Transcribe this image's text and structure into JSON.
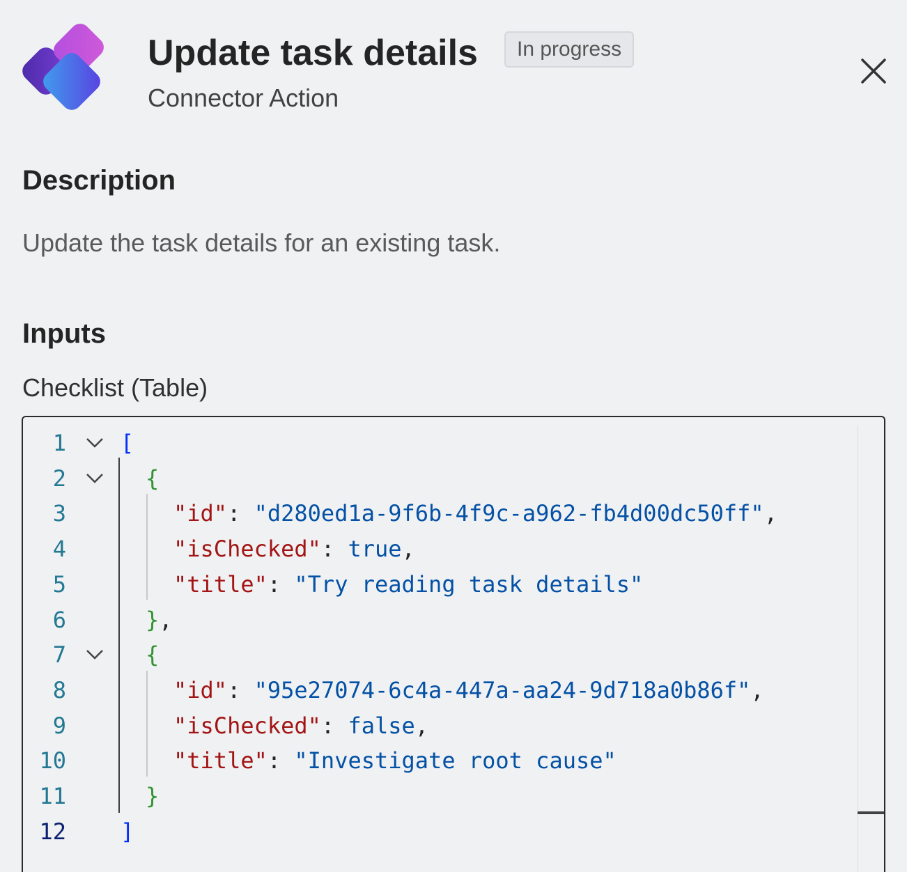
{
  "header": {
    "title": "Update task details",
    "status_badge": "In progress",
    "subtitle": "Connector Action",
    "app_icon": "planner-logo-icon",
    "close_icon": "close-icon"
  },
  "description": {
    "heading": "Description",
    "text": "Update the task details for an existing task."
  },
  "inputs": {
    "heading": "Inputs",
    "field_label": "Checklist (Table)",
    "line_numbers": [
      "1",
      "2",
      "3",
      "4",
      "5",
      "6",
      "7",
      "8",
      "9",
      "10",
      "11",
      "12"
    ],
    "lines": [
      {
        "open": "["
      },
      {
        "open": "{"
      },
      {
        "key": "\"id\"",
        "sep": ": ",
        "value": "\"d280ed1a-9f6b-4f9c-a962-fb4d00dc50ff\"",
        "end": ","
      },
      {
        "key": "\"isChecked\"",
        "sep": ": ",
        "value": "true",
        "end": ","
      },
      {
        "key": "\"title\"",
        "sep": ": ",
        "value": "\"Try reading task details\"",
        "end": ""
      },
      {
        "close": "}",
        "end": ","
      },
      {
        "open": "{"
      },
      {
        "key": "\"id\"",
        "sep": ": ",
        "value": "\"95e27074-6c4a-447a-aa24-9d718a0b86f\"",
        "end": ","
      },
      {
        "key": "\"isChecked\"",
        "sep": ": ",
        "value": "false",
        "end": ","
      },
      {
        "key": "\"title\"",
        "sep": ": ",
        "value": "\"Investigate root cause\"",
        "end": ""
      },
      {
        "close": "}",
        "end": ""
      },
      {
        "close": "]",
        "end": ""
      }
    ]
  },
  "colors": {
    "brand_purple": "#7b3fe4",
    "brand_blue": "#2f7fe6",
    "brand_magenta": "#c14fe0"
  }
}
